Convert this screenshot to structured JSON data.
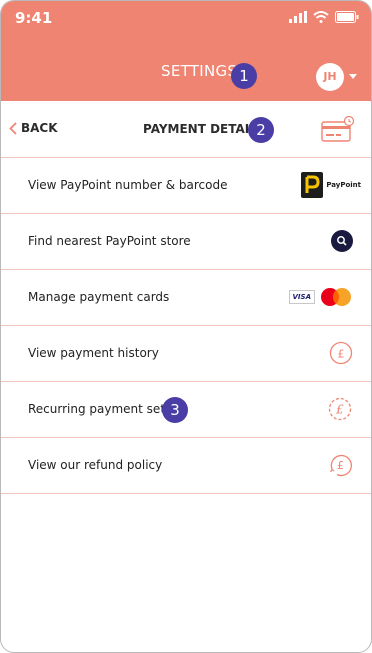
{
  "status_bar": {
    "time": "9:41"
  },
  "header": {
    "title": "SETTINGS",
    "badge_1": "1",
    "avatar_initials": "JH"
  },
  "subheader": {
    "back_label": "BACK",
    "title": "PAYMENT DETAILS",
    "badge_2": "2"
  },
  "menu": {
    "items": [
      {
        "label": "View PayPoint number & barcode",
        "icon": "paypoint-logo-icon",
        "icon_text": "PayPoint"
      },
      {
        "label": "Find nearest PayPoint store",
        "icon": "search-icon"
      },
      {
        "label": "Manage payment cards",
        "icon": "visa-mastercard-icon",
        "icon_text": "VISA"
      },
      {
        "label": "View payment history",
        "icon": "pound-circle-icon"
      },
      {
        "label": "Recurring payment set-up",
        "icon": "pound-recurring-icon",
        "badge": "3"
      },
      {
        "label": "View our refund policy",
        "icon": "pound-refund-icon"
      }
    ]
  },
  "colors": {
    "brand": "#ef8472",
    "badge": "#4a3ea6",
    "divider": "#f1c7bf"
  }
}
